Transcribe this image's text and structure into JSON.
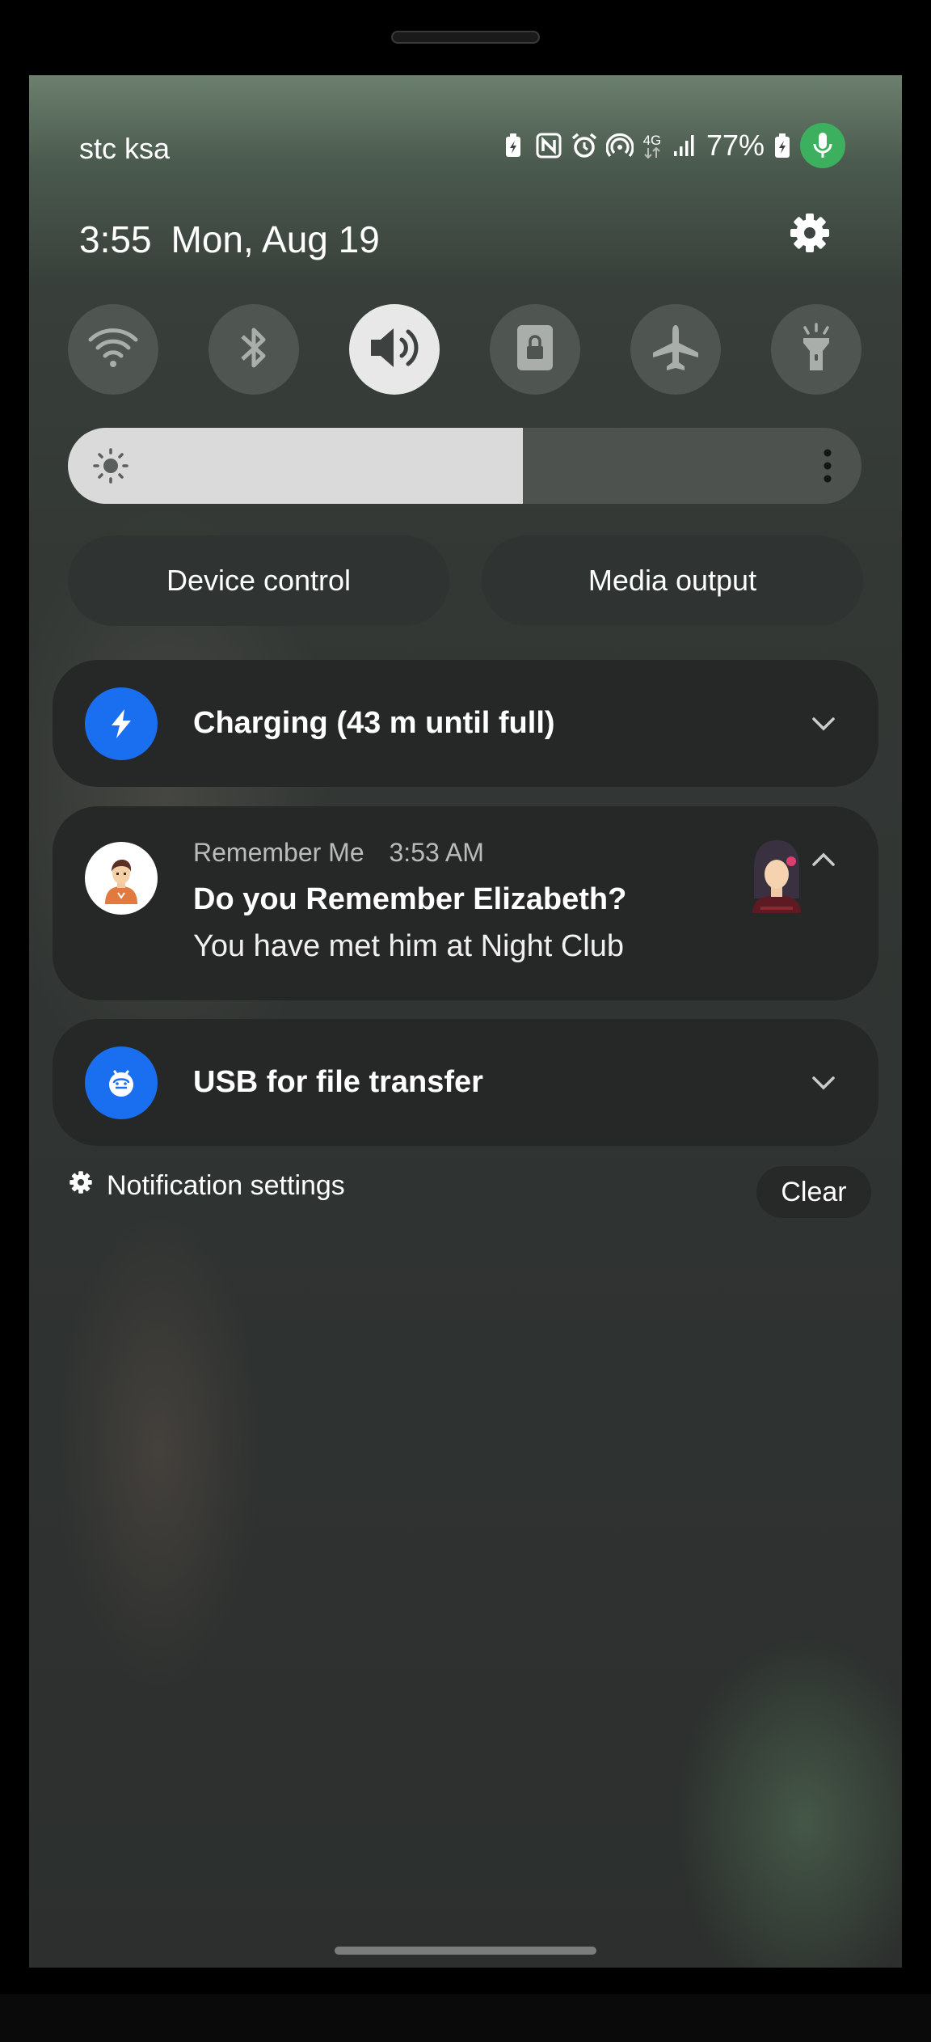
{
  "status_bar": {
    "carrier": "stc ksa",
    "network": "4G",
    "battery_percent": "77%",
    "icons": [
      "battery-saver-icon",
      "nfc-icon",
      "alarm-icon",
      "hotspot-icon",
      "network-4g-icon",
      "signal-icon",
      "battery-charging-icon",
      "mic-active-icon"
    ],
    "mic_color": "#3db060"
  },
  "header": {
    "time": "3:55",
    "date": "Mon, Aug 19"
  },
  "quick_settings": {
    "toggles": [
      {
        "name": "wifi",
        "icon": "wifi-icon",
        "active": false
      },
      {
        "name": "bluetooth",
        "icon": "bluetooth-icon",
        "active": false
      },
      {
        "name": "sound",
        "icon": "sound-icon",
        "active": true
      },
      {
        "name": "portrait-lock",
        "icon": "rotation-lock-icon",
        "active": false
      },
      {
        "name": "airplane-mode",
        "icon": "airplane-icon",
        "active": false
      },
      {
        "name": "flashlight",
        "icon": "flashlight-icon",
        "active": false
      }
    ],
    "brightness_level": 0.573,
    "device_control_label": "Device control",
    "media_output_label": "Media output"
  },
  "notifications": {
    "charging": {
      "title": "Charging (43 m until full)",
      "icon": "lightning-icon",
      "icon_bg": "#1a6ff0"
    },
    "app": {
      "app_name": "Remember Me",
      "time": "3:53 AM",
      "title": "Do you Remember Elizabeth?",
      "text": "You have met him at Night Club",
      "app_icon": "person-avatar-icon",
      "thumbnail": "woman-avatar-icon"
    },
    "usb": {
      "title": "USB for file transfer",
      "icon": "usb-icon",
      "icon_bg": "#1a6ff0"
    }
  },
  "footer": {
    "notification_settings_label": "Notification settings",
    "clear_label": "Clear"
  }
}
